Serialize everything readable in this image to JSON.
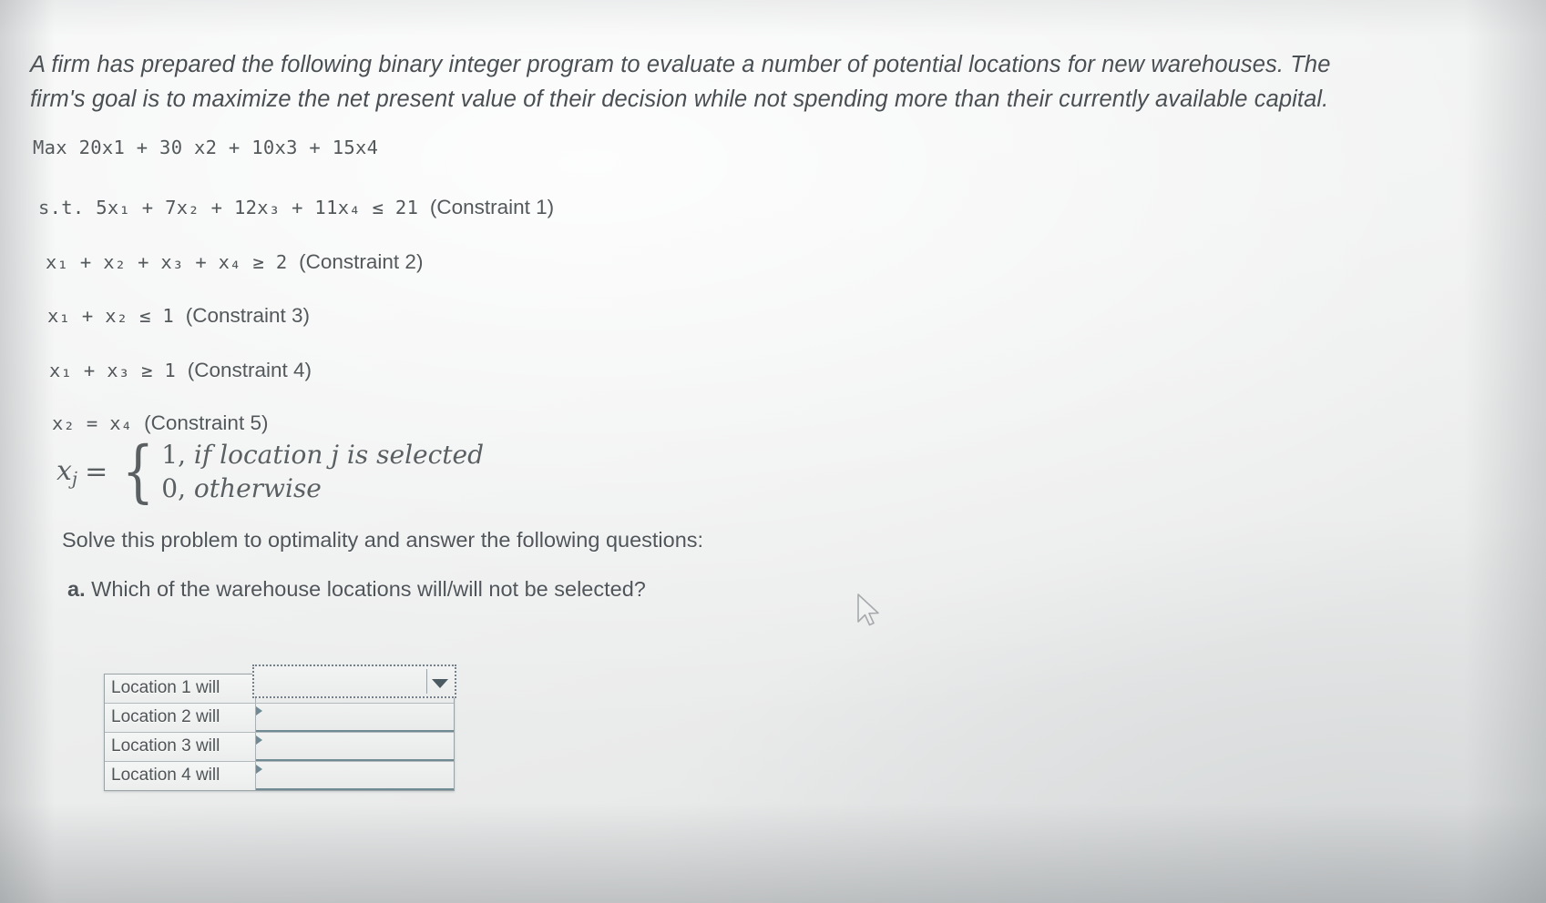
{
  "problem": {
    "intro": "A firm has prepared the following binary integer program to evaluate a number of potential locations for new warehouses. The firm's goal is to maximize the net present value of their decision while not spending more than their currently available capital.",
    "objective": {
      "keyword": "Max",
      "expression": "20x₁ + 30 x₂ + 10x₃ + 15x₄",
      "full": "Max 20x1 + 30 x2 + 10x3 + 15x4"
    },
    "constraints": [
      {
        "prefix": "s.t.",
        "expression": "5x₁ + 7x₂ + 12x₃ + 11x₄ ≤ 21",
        "label": "(Constraint 1)"
      },
      {
        "prefix": "",
        "expression": "x₁ + x₂ + x₃ + x₄ ≥ 2",
        "label": "(Constraint 2)"
      },
      {
        "prefix": "",
        "expression": "x₁ + x₂ ≤ 1",
        "label": "(Constraint 3)"
      },
      {
        "prefix": "",
        "expression": "x₁ + x₃ ≥ 1",
        "label": "(Constraint 4)"
      },
      {
        "prefix": "",
        "expression": "x₂ = x₄",
        "label": "(Constraint 5)"
      }
    ],
    "piecewise": {
      "variable": "x",
      "subscript": "j",
      "equals": "=",
      "case_one_value": "1,",
      "case_one_text": "if location j is selected",
      "case_two_value": "0,",
      "case_two_text": "otherwise"
    },
    "solve_prompt": "Solve this problem to optimality and answer the following questions:",
    "question_a": {
      "label": "a.",
      "text": "Which of the warehouse locations will/will not be selected?"
    }
  },
  "answer_table": {
    "rows": [
      {
        "label": "Location 1 will",
        "value": ""
      },
      {
        "label": "Location 2 will",
        "value": ""
      },
      {
        "label": "Location 3 will",
        "value": ""
      },
      {
        "label": "Location 4 will",
        "value": ""
      }
    ]
  },
  "icons": {
    "dropdown_arrow": "chevron-down-icon",
    "mouse_cursor": "mouse-pointer-icon"
  },
  "colors": {
    "page_background": "#eeefef",
    "text": "#4c5154",
    "field_underline": "#6f8a93",
    "focus_border": "#76808a"
  }
}
